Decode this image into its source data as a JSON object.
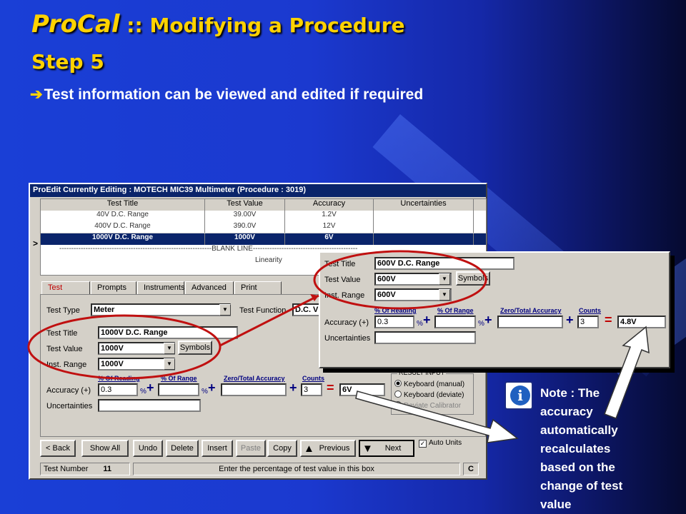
{
  "slide": {
    "title_brand": "ProCal",
    "title_sep": " :: ",
    "title_rest": "Modifying a Procedure",
    "step": "Step 5",
    "bullet_arrow": "è",
    "bullet": "Test information can be viewed and edited if required",
    "note": "Note : The accuracy automatically recalculates based on the change of test value"
  },
  "window": {
    "title": "ProEdit Currently Editing : MOTECH MIC39 Multimeter (Procedure : 3019)",
    "grid": {
      "headers": [
        "Test Title",
        "Test Value",
        "Accuracy",
        "Uncertainties"
      ],
      "rows": [
        [
          "40V D.C. Range",
          "39.00V",
          "1.2V",
          ""
        ],
        [
          "400V D.C. Range",
          "390.0V",
          "12V",
          ""
        ],
        [
          "1000V D.C. Range",
          "1000V",
          "6V",
          ""
        ],
        [
          "----------------------------------------------------------------BLANK LINE--------------------------------------------",
          "",
          "",
          ""
        ],
        [
          "Linearity",
          "",
          "",
          ""
        ]
      ],
      "selected_row": 2,
      "pointer": ">"
    },
    "tabs": [
      "Test",
      "Prompts",
      "Instruments",
      "Advanced",
      "Print"
    ],
    "active_tab": "Test",
    "form": {
      "test_type_label": "Test Type",
      "test_type_value": "Meter",
      "test_function_label": "Test Function",
      "test_function_value": "D.C. V",
      "test_title_label": "Test Title",
      "test_title_value": "1000V D.C. Range",
      "test_value_label": "Test Value",
      "test_value_value": "1000V",
      "inst_range_label": "Inst. Range",
      "inst_range_value": "1000V",
      "symbols_label": "Symbols",
      "pct_reading_label": "% Of Reading",
      "pct_range_label": "% Of Range",
      "zero_total_label": "Zero/Total Accuracy",
      "counts_label": "Counts",
      "accuracy_label": "Accuracy (+)",
      "pct_reading_value": "0.3",
      "pct_range_value": "",
      "zero_total_value": "",
      "counts_value": "3",
      "result_value": "6V",
      "uncertainties_label": "Uncertainties",
      "uncertainties_value": "",
      "pct_sign": "%",
      "plus_sign": "+",
      "equals_sign": "="
    },
    "result_input": {
      "label": "RESULT INPUT",
      "options": [
        "Keyboard (manual)",
        "Keyboard (deviate)",
        "Deviate Calibrator"
      ],
      "selected": 0
    },
    "buttons": {
      "back": "< Back",
      "show_all": "Show All",
      "undo": "Undo",
      "delete": "Delete",
      "insert": "Insert",
      "paste": "Paste",
      "copy": "Copy",
      "previous": "Previous",
      "next": "Next"
    },
    "auto_units": {
      "label": "Auto Units",
      "checked": true
    },
    "status": {
      "test_number_label": "Test Number",
      "test_number_value": "11",
      "message": "Enter the percentage of test value in this box",
      "mode": "C"
    }
  },
  "zoom": {
    "test_title_label": "Test Title",
    "test_title_value": "600V D.C. Range",
    "test_value_label": "Test Value",
    "test_value_value": "600V",
    "inst_range_label": "Inst. Range",
    "inst_range_value": "600V",
    "symbols_label": "Symbols",
    "pct_reading_label": "% Of Reading",
    "pct_range_label": "% Of Range",
    "zero_total_label": "Zero/Total Accuracy",
    "counts_label": "Counts",
    "accuracy_label": "Accuracy (+)",
    "pct_reading_value": "0.3",
    "counts_value": "3",
    "result_value": "4.8V",
    "uncertainties_label": "Uncertainties"
  },
  "colors": {
    "title": "#ffd200",
    "highlight": "#0a246a",
    "annotation": "#c01010"
  },
  "icons": [
    "info-icon",
    "arrow-up-icon",
    "arrow-down-icon",
    "checkbox-icon",
    "dropdown-arrow-icon"
  ]
}
